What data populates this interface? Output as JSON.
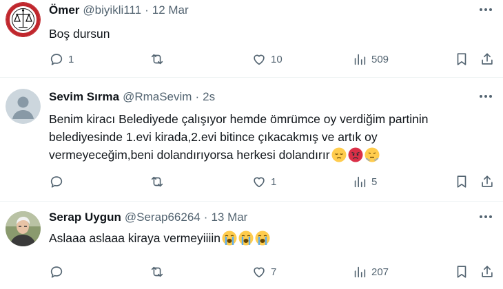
{
  "tweets": [
    {
      "name": "Ömer",
      "handle": "@biyikli111",
      "dot": "·",
      "time": "12 Mar",
      "text": "Boş dursun",
      "emojis": [],
      "replies": "1",
      "retweets": "",
      "likes": "10",
      "views": "509",
      "avatar": "circular red seal logo"
    },
    {
      "name": "Sevim Sırma",
      "handle": "@RmaSevim",
      "dot": "·",
      "time": "2s",
      "text_lines": [
        "Benim kiracı Belediyede çalışıyor hemde ömrümce  oy verdiğim partinin",
        "belediyesinde 1.evi kirada,2.evi bitince çıkacakmış ve artık oy",
        "vermeyeceğim,beni dolandırıyorsa herkesi dolandırır"
      ],
      "emojis": [
        "pensive-face",
        "angry-face",
        "steam-face"
      ],
      "replies": "",
      "retweets": "",
      "likes": "1",
      "views": "5",
      "avatar": "default-profile"
    },
    {
      "name": "Serap Uygun",
      "handle": "@Serap66264",
      "dot": "·",
      "time": "13 Mar",
      "text": "Aslaaa aslaaa kiraya vermeyiiiin",
      "emojis": [
        "crying-face",
        "crying-face",
        "crying-face"
      ],
      "replies": "",
      "retweets": "",
      "likes": "7",
      "views": "207",
      "avatar": "photo"
    }
  ],
  "colors": {
    "text": "#0f1419",
    "secondary": "#536471",
    "divider": "#eff3f4",
    "seal_red": "#c0272d"
  }
}
